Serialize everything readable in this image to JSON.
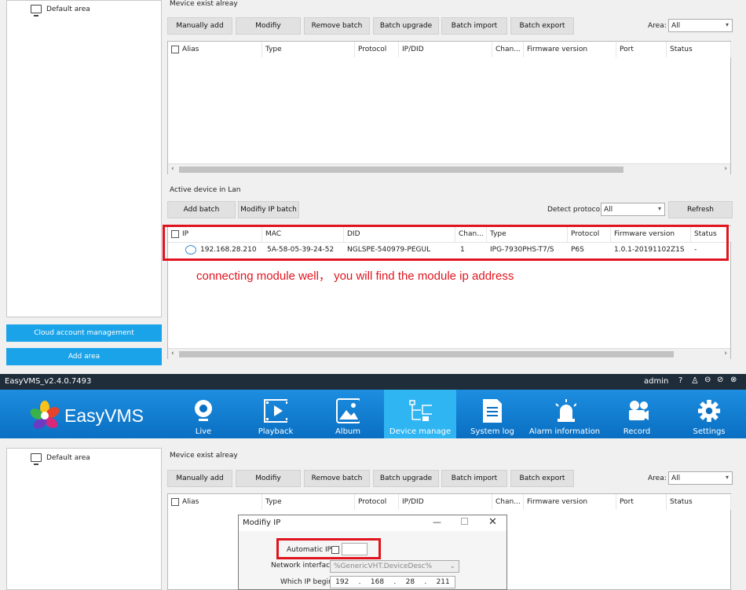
{
  "tree": {
    "default_area": "Default area"
  },
  "exist_section": {
    "label": "Mevice exist alreay",
    "buttons": [
      "Manually add",
      "Modifiy",
      "Remove batch",
      "Batch upgrade",
      "Batch import",
      "Batch export"
    ],
    "area_label": "Area:",
    "area_value": "All",
    "columns": [
      "Alias",
      "Type",
      "Protocol",
      "IP/DID",
      "Chan...",
      "Firmware version",
      "Port",
      "Status"
    ]
  },
  "lan_section": {
    "label": "Active device in Lan",
    "add_batch": "Add batch",
    "modify_ip_batch": "Modifiy IP batch",
    "detect_label": "Detect protocol:",
    "detect_value": "All",
    "refresh": "Refresh",
    "columns": [
      "IP",
      "MAC",
      "DID",
      "Chan...",
      "Type",
      "Protocol",
      "Firmware version",
      "Status"
    ],
    "row": {
      "ip": "192.168.28.210",
      "mac": "5A-58-05-39-24-52",
      "did": "NGLSPE-540979-PEGUL",
      "chan": "1",
      "type": "IPG-7930PHS-T7/S",
      "protocol": "P6S",
      "firmware": "1.0.1-20191102Z1S",
      "status": "-"
    }
  },
  "annotation": "connecting module well，  you will find the module ip address",
  "side_buttons": {
    "cloud": "Cloud account management",
    "add_area": "Add area"
  },
  "app": {
    "title": "EasyVMS_v2.4.0.7493",
    "user": "admin",
    "brand": "EasyVMS"
  },
  "nav": [
    {
      "label": "Live",
      "icon": "webcam-icon"
    },
    {
      "label": "Playback",
      "icon": "film-play-icon"
    },
    {
      "label": "Album",
      "icon": "image-icon"
    },
    {
      "label": "Device manage",
      "icon": "network-device-icon"
    },
    {
      "label": "System log",
      "icon": "document-log-icon"
    },
    {
      "label": "Alarm information",
      "icon": "alarm-light-icon"
    },
    {
      "label": "Record",
      "icon": "recorder-icon"
    },
    {
      "label": "Settings",
      "icon": "gear-icon"
    }
  ],
  "dialog": {
    "title": "Modifiy IP",
    "automatic_ip": "Automatic IP",
    "network_interface_label": "Network interface",
    "network_interface_value": "%GenericVHT.DeviceDesc%",
    "which_ip_label": "Which IP begin",
    "ip_parts": [
      "192",
      "168",
      "28",
      "211"
    ]
  },
  "colors": {
    "accent": "#1aa3e8",
    "highlight": "#e0141e",
    "nav_active": "#2fb5f2"
  }
}
